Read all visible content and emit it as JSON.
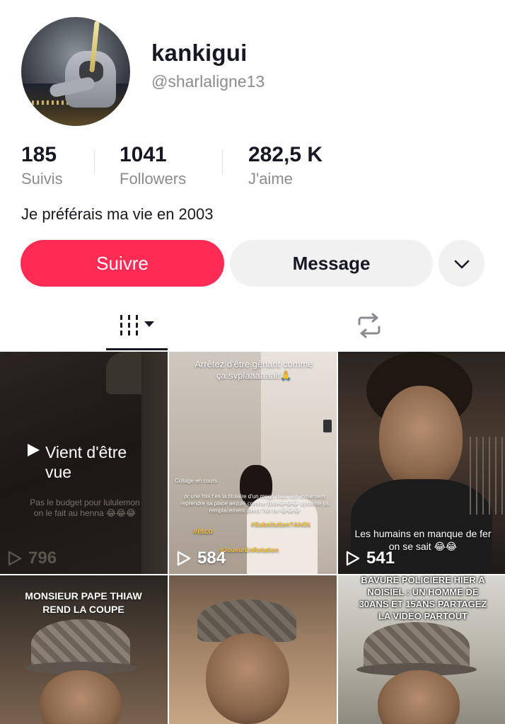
{
  "profile": {
    "name": "kankigui",
    "handle": "@sharlaligne13",
    "bio": "Je préférais ma vie en 2003"
  },
  "stats": [
    {
      "value": "185",
      "label": "Suivis"
    },
    {
      "value": "1041",
      "label": "Followers"
    },
    {
      "value": "282,5 K",
      "label": "J'aime"
    }
  ],
  "actions": {
    "follow_label": "Suivre",
    "message_label": "Message",
    "more_icon": "chevron-down-icon"
  },
  "tabs": {
    "videos_icon": "grid-icon",
    "reposts_icon": "repost-icon"
  },
  "colors": {
    "follow_button": "#fe2c55",
    "secondary_button": "#f1f1f2",
    "muted_text": "#8a8b91"
  },
  "videos": [
    {
      "caption": "Vient d'être vue",
      "subcaption": "Pas le budget pour lululemon on le fait au henna 😂😂😂",
      "views": "796"
    },
    {
      "caption": "Arrêtez d'être gênant comme ça svplaaaaaait🙏",
      "overlay_1": "Collage en cours",
      "overlay_2": "pr une fois t'es la titulaire d'un mogo mais son extrement reprendre sa place aezulé comme Bale😂😂😂 système ya remplacement direct ?ah bv 😂😂😂",
      "tag_1": "#isco",
      "tag_2": "#Subsitution?AhOk",
      "tag_3": "#JoueurEnRotation",
      "views": "584"
    },
    {
      "caption": "Les humains en manque de fer on se sait 😂😂",
      "views": "541"
    },
    {
      "caption": "MONSIEUR PAPE THIAW REND LA COUPE"
    },
    {
      "caption": ""
    },
    {
      "caption": "BAVURE POLICIERE HIER À NOISIEL : UN HOMME DE 30ANS ET 15ANS PARTAGEZ LA VIDÉO PARTOUT"
    }
  ]
}
